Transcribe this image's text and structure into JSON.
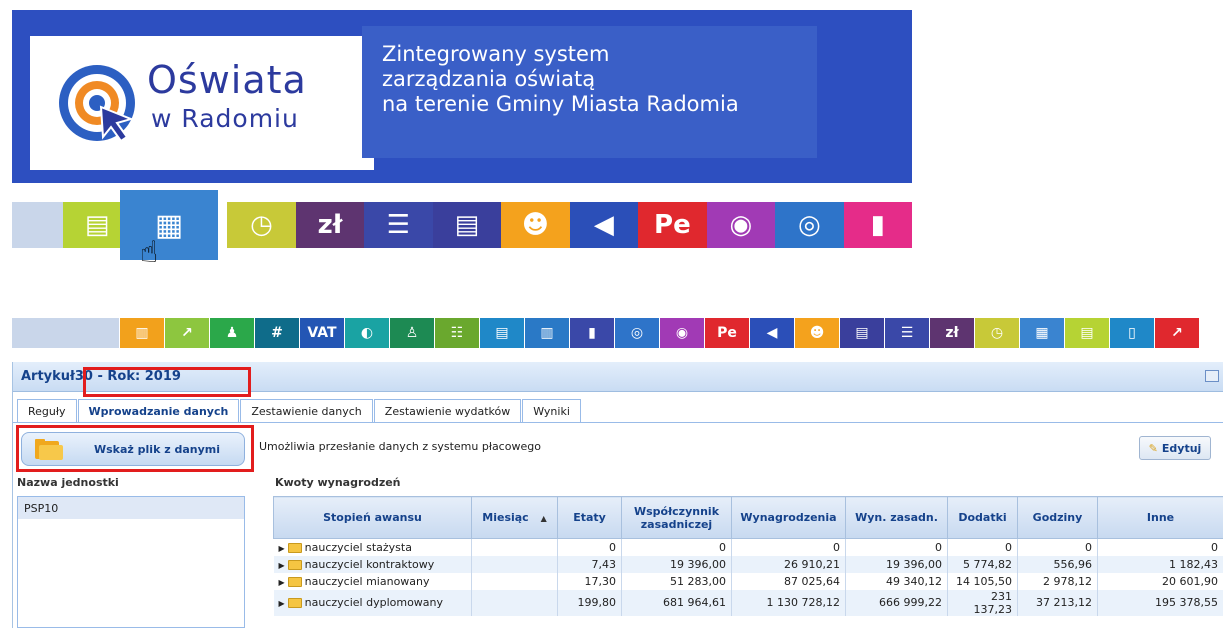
{
  "banner": {
    "logo_title": "Oświata",
    "logo_subtitle": "w Radomiu",
    "tagline": [
      "Zintegrowany system",
      "zarządzania oświatą",
      "na terenie Gminy Miasta Radomia"
    ]
  },
  "big_tiles": [
    {
      "name": "database-chart-icon",
      "color": "#b6d334",
      "glyph": "▤"
    },
    {
      "name": "money-icon",
      "color": "#3a84d0",
      "glyph": "▦",
      "active": true
    },
    {
      "name": "time-money-icon",
      "color": "#c8c938",
      "glyph": "◷"
    },
    {
      "name": "zloty-icon",
      "color": "#5e3470",
      "glyph": "zł"
    },
    {
      "name": "stairs-icon",
      "color": "#3a48a8",
      "glyph": "☰"
    },
    {
      "name": "document-icon",
      "color": "#3a3f9c",
      "glyph": "▤"
    },
    {
      "name": "people-icon",
      "color": "#f4a21d",
      "glyph": "☻"
    },
    {
      "name": "megaphone-icon",
      "color": "#2b4fb8",
      "glyph": "◀"
    },
    {
      "name": "e-document-icon",
      "color": "#e0282e",
      "glyph": "Pe"
    },
    {
      "name": "bear-icon",
      "color": "#a13ab5",
      "glyph": "◉"
    },
    {
      "name": "target-icon",
      "color": "#2e74c9",
      "glyph": "◎"
    },
    {
      "name": "book-icon",
      "color": "#e52c89",
      "glyph": "▮"
    }
  ],
  "small_tiles": [
    {
      "name": "chart-icon",
      "color": "#f2a11c",
      "glyph": "▥"
    },
    {
      "name": "growth-chart-icon",
      "color": "#8dc63f",
      "glyph": "↗"
    },
    {
      "name": "person-desk-icon",
      "color": "#2ba84a",
      "glyph": "♟"
    },
    {
      "name": "numbers-icon",
      "color": "#0f6c8a",
      "glyph": "#"
    },
    {
      "name": "vat-icon",
      "color": "#2456b4",
      "glyph": "VAT"
    },
    {
      "name": "cycle-icon",
      "color": "#1aa3a3",
      "glyph": "◐"
    },
    {
      "name": "user-list-icon",
      "color": "#1d8a53",
      "glyph": "♙"
    },
    {
      "name": "list-check-icon",
      "color": "#6aa82e",
      "glyph": "☷"
    },
    {
      "name": "books-icon",
      "color": "#1f88c8",
      "glyph": "▤"
    },
    {
      "name": "open-book-icon",
      "color": "#2a79c6",
      "glyph": "▥"
    },
    {
      "name": "book-icon",
      "color": "#3a48a8",
      "glyph": "▮"
    },
    {
      "name": "target-icon",
      "color": "#2e74c9",
      "glyph": "◎"
    },
    {
      "name": "bear-icon",
      "color": "#a13ab5",
      "glyph": "◉"
    },
    {
      "name": "e-document-icon",
      "color": "#e0282e",
      "glyph": "Pe"
    },
    {
      "name": "megaphone-icon",
      "color": "#2b4fb8",
      "glyph": "◀"
    },
    {
      "name": "people-icon",
      "color": "#f4a21d",
      "glyph": "☻"
    },
    {
      "name": "document-icon",
      "color": "#3a3f9c",
      "glyph": "▤"
    },
    {
      "name": "stairs-icon",
      "color": "#3a48a8",
      "glyph": "☰"
    },
    {
      "name": "zloty-icon",
      "color": "#5e3470",
      "glyph": "zł"
    },
    {
      "name": "time-money-icon",
      "color": "#c8c938",
      "glyph": "◷"
    },
    {
      "name": "money-icon",
      "color": "#3a84d0",
      "glyph": "▦"
    },
    {
      "name": "database-chart-icon",
      "color": "#b6d334",
      "glyph": "▤"
    },
    {
      "name": "coins-icon",
      "color": "#1f88c8",
      "glyph": "▯"
    },
    {
      "name": "growth-icon",
      "color": "#e0282e",
      "glyph": "↗"
    }
  ],
  "panel": {
    "title": "Artykuł30 - Rok: 2019",
    "tabs": [
      "Reguły",
      "Wprowadzanie danych",
      "Zestawienie danych",
      "Zestawienie wydatków",
      "Wyniki"
    ],
    "active_tab": 1,
    "upload_label": "Wskaż plik z danymi",
    "description": "Umożliwia przesłanie danych z systemu płacowego",
    "edit_label": "Edytuj",
    "units_title": "Nazwa jednostki",
    "units": [
      "PSP10"
    ],
    "amounts_title": "Kwoty wynagrodzeń"
  },
  "grid": {
    "columns": [
      "Stopień awansu",
      "Miesiąc",
      "Etaty",
      "Współczynnik zasadniczej",
      "Wynagrodzenia",
      "Wyn. zasadn.",
      "Dodatki",
      "Godziny",
      "Inne"
    ],
    "sort_indicator": "▲",
    "rows": [
      [
        "nauczyciel stażysta",
        "",
        "0",
        "0",
        "0",
        "0",
        "0",
        "0",
        "0"
      ],
      [
        "nauczyciel kontraktowy",
        "",
        "7,43",
        "19 396,00",
        "26 910,21",
        "19 396,00",
        "5 774,82",
        "556,96",
        "1 182,43"
      ],
      [
        "nauczyciel mianowany",
        "",
        "17,30",
        "51 283,00",
        "87 025,64",
        "49 340,12",
        "14 105,50",
        "2 978,12",
        "20 601,90"
      ],
      [
        "nauczyciel dyplomowany",
        "",
        "199,80",
        "681 964,61",
        "1 130 728,12",
        "666 999,22",
        "231 137,23",
        "37 213,12",
        "195 378,55"
      ]
    ]
  }
}
